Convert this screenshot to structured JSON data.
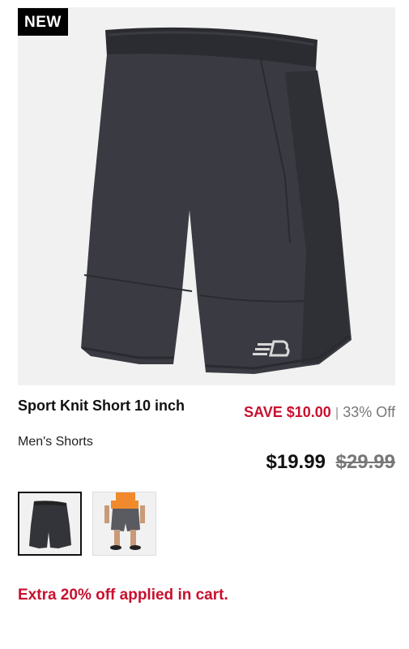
{
  "product": {
    "badge": "NEW",
    "title": "Sport Knit Short 10 inch",
    "category": "Men's Shorts",
    "image_icon": "shorts-product-image",
    "logo_icon": "brand-logo-icon"
  },
  "pricing": {
    "save_label": "SAVE $10.00",
    "separator": "|",
    "discount_pct": "33% Off",
    "current_price": "$19.99",
    "original_price": "$29.99"
  },
  "thumbnails": [
    {
      "name": "thumbnail-shorts-flat",
      "selected": true
    },
    {
      "name": "thumbnail-shorts-model",
      "selected": false
    }
  ],
  "promo": {
    "text": "Extra 20% off applied in cart."
  },
  "colors": {
    "sale_red": "#c8102e",
    "text_dark": "#111111",
    "muted": "#777777",
    "image_bg": "#f1f1f1"
  }
}
